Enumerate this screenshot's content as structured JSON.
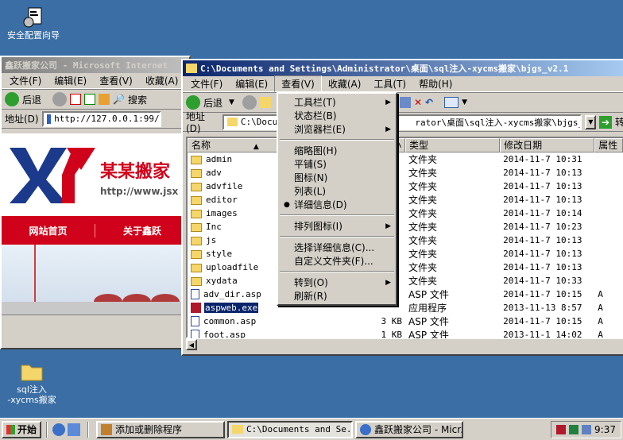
{
  "desktop": {
    "icon_security": "安全配置向导",
    "icon_sql": "sql注入\n-xycms搬家"
  },
  "ie": {
    "title": "鑫跃搬家公司 - Microsoft Internet",
    "menu": [
      "文件(F)",
      "编辑(E)",
      "查看(V)",
      "收藏(A)"
    ],
    "toolbar": {
      "back": "后退",
      "search": "搜索"
    },
    "address_label": "地址(D)",
    "url": "http://127.0.0.1:99/",
    "site": {
      "brand": "某某搬家",
      "site_url": "http://www.jsx",
      "nav": [
        "网站首页",
        "关于鑫跃"
      ]
    }
  },
  "explorer": {
    "title": "C:\\Documents and Settings\\Administrator\\桌面\\sql注入-xycms搬家\\bjgs_v2.1",
    "menu": [
      "文件(F)",
      "编辑(E)",
      "查看(V)",
      "收藏(A)",
      "工具(T)",
      "帮助(H)"
    ],
    "toolbar": {
      "back": "后退",
      "go": "转"
    },
    "address_label": "地址(D)",
    "address_left": "C:\\Documents",
    "address_right": "rator\\桌面\\sql注入-xycms搬家\\bjgs_v2.1",
    "columns": {
      "name": "名称",
      "size": "大小",
      "type": "类型",
      "modified": "修改日期",
      "attr": "属性"
    },
    "files": [
      {
        "name": "admin",
        "kind": "folder",
        "size": "",
        "type": "文件夹",
        "date": "2014-11-7 10:31",
        "attr": ""
      },
      {
        "name": "adv",
        "kind": "folder",
        "size": "",
        "type": "文件夹",
        "date": "2014-11-7 10:13",
        "attr": ""
      },
      {
        "name": "advfile",
        "kind": "folder",
        "size": "",
        "type": "文件夹",
        "date": "2014-11-7 10:13",
        "attr": ""
      },
      {
        "name": "editor",
        "kind": "folder",
        "size": "",
        "type": "文件夹",
        "date": "2014-11-7 10:13",
        "attr": ""
      },
      {
        "name": "images",
        "kind": "folder",
        "size": "",
        "type": "文件夹",
        "date": "2014-11-7 10:14",
        "attr": ""
      },
      {
        "name": "Inc",
        "kind": "folder",
        "size": "",
        "type": "文件夹",
        "date": "2014-11-7 10:23",
        "attr": ""
      },
      {
        "name": "js",
        "kind": "folder",
        "size": "",
        "type": "文件夹",
        "date": "2014-11-7 10:13",
        "attr": ""
      },
      {
        "name": "style",
        "kind": "folder",
        "size": "",
        "type": "文件夹",
        "date": "2014-11-7 10:13",
        "attr": ""
      },
      {
        "name": "uploadfile",
        "kind": "folder",
        "size": "",
        "type": "文件夹",
        "date": "2014-11-7 10:13",
        "attr": ""
      },
      {
        "name": "xydata",
        "kind": "folder",
        "size": "",
        "type": "文件夹",
        "date": "2014-11-7 10:33",
        "attr": ""
      },
      {
        "name": "adv_dir.asp",
        "kind": "file",
        "size": "",
        "type": "ASP 文件",
        "date": "2014-11-7 10:15",
        "attr": "A"
      },
      {
        "name": "aspweb.exe",
        "kind": "exe",
        "size": "",
        "type": "应用程序",
        "date": "2013-11-13 8:57",
        "attr": "A"
      },
      {
        "name": "common.asp",
        "kind": "file",
        "size": "3 KB",
        "type": "ASP 文件",
        "date": "2014-11-7 10:15",
        "attr": "A"
      },
      {
        "name": "foot.asp",
        "kind": "file",
        "size": "1 KB",
        "type": "ASP 文件",
        "date": "2013-11-1 14:02",
        "attr": "A"
      }
    ]
  },
  "view_menu": {
    "items": [
      {
        "label": "工具栏(T)",
        "arrow": true
      },
      {
        "label": "状态栏(B)",
        "arrow": false
      },
      {
        "label": "浏览器栏(E)",
        "arrow": true
      },
      {
        "sep": true
      },
      {
        "label": "缩略图(H)",
        "arrow": false
      },
      {
        "label": "平铺(S)",
        "arrow": false
      },
      {
        "label": "图标(N)",
        "arrow": false
      },
      {
        "label": "列表(L)",
        "arrow": false
      },
      {
        "label": "详细信息(D)",
        "arrow": false,
        "checked": true
      },
      {
        "sep": true
      },
      {
        "label": "排列图标(I)",
        "arrow": true
      },
      {
        "sep": true
      },
      {
        "label": "选择详细信息(C)...",
        "arrow": false
      },
      {
        "label": "自定义文件夹(F)...",
        "arrow": false
      },
      {
        "sep": true
      },
      {
        "label": "转到(O)",
        "arrow": true
      },
      {
        "label": "刷新(R)",
        "arrow": false
      }
    ]
  },
  "taskbar": {
    "start": "开始",
    "tasks": [
      "添加或删除程序",
      "C:\\Documents and Se...",
      "鑫跃搬家公司 - Micr..."
    ],
    "clock": "9:37"
  },
  "colors": {
    "desktop": "#3a6ea5",
    "title_active": "#0a246a",
    "site_red": "#d0021b"
  }
}
